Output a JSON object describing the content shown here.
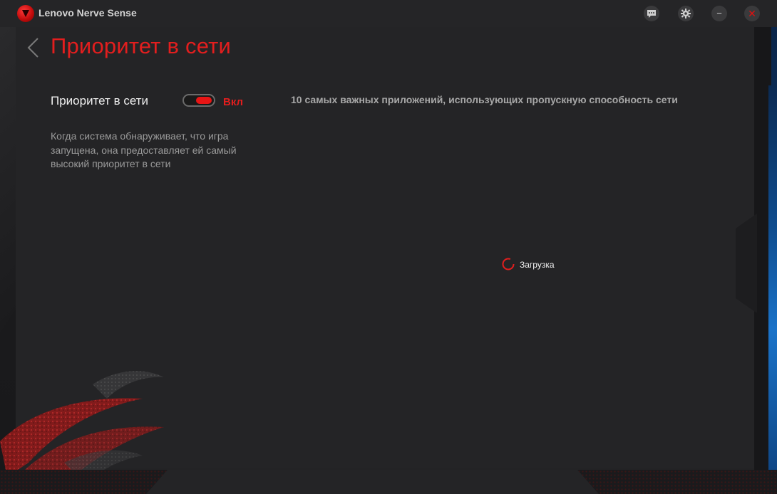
{
  "titlebar": {
    "app_name": "Lenovo Nerve Sense",
    "buttons": [
      {
        "name": "feedback",
        "icon": "chat-bubble-icon"
      },
      {
        "name": "settings",
        "icon": "gear-icon"
      },
      {
        "name": "minimize",
        "icon": "minus-icon",
        "glyph": "−"
      },
      {
        "name": "close",
        "icon": "close-icon",
        "glyph": "✕"
      }
    ]
  },
  "header": {
    "title": "Приоритет в сети"
  },
  "setting": {
    "label": "Приоритет в сети",
    "state_label": "Вкл",
    "enabled": true,
    "description": "Когда система обнаруживает, что игра запущена, она предоставляет ей самый высокий приоритет в сети"
  },
  "apps_panel": {
    "heading": "10 самых важных приложений, использующих пропускную способность сети",
    "loading_text": "Загрузка"
  },
  "colors": {
    "accent": "#e31e1e",
    "background": "#242426",
    "text": "#f0f0f0",
    "muted_text": "#9a9a9a"
  }
}
